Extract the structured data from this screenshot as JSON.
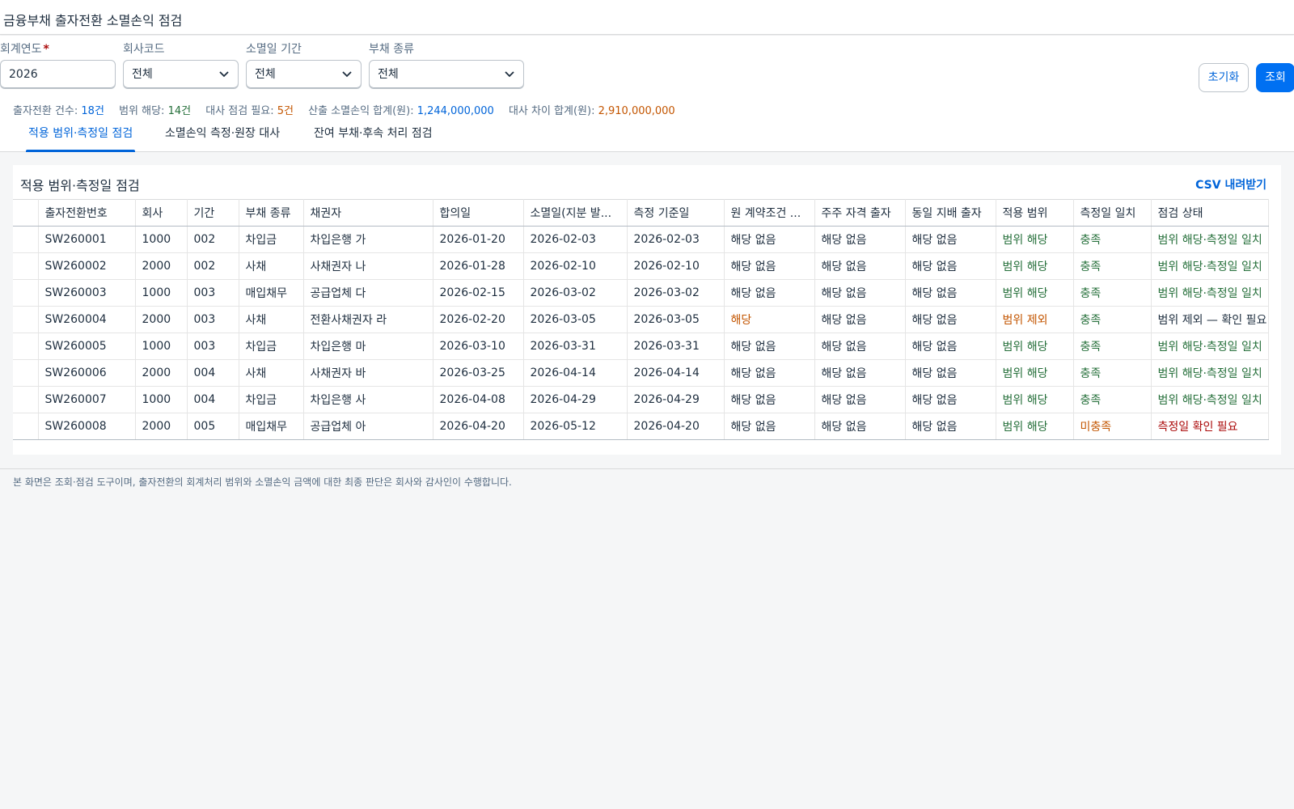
{
  "app": {
    "title": "금융부채 출자전환 소멸손익 점검"
  },
  "filters": [
    {
      "label": "회계연도",
      "required": true,
      "value": "2026",
      "type": "input"
    },
    {
      "label": "회사코드",
      "required": false,
      "value": "전체",
      "type": "select"
    },
    {
      "label": "소멸일 기간",
      "required": false,
      "value": "전체",
      "type": "select"
    },
    {
      "label": "부채 종류",
      "required": false,
      "value": "전체",
      "type": "select"
    }
  ],
  "buttons": {
    "reset": "초기화",
    "search": "조회"
  },
  "stats": [
    {
      "label": "출자전환 건수: ",
      "value": "18건",
      "tone": "blue"
    },
    {
      "label": "범위 해당: ",
      "value": "14건",
      "tone": "green"
    },
    {
      "label": "대사 점검 필요: ",
      "value": "5건",
      "tone": "orange"
    },
    {
      "label": "산출 소멸손익 합계(원): ",
      "value": "1,244,000,000",
      "tone": "blue"
    },
    {
      "label": "대사 차이 합계(원): ",
      "value": "2,910,000,000",
      "tone": "orange"
    }
  ],
  "tabs": [
    {
      "label": "적용 범위·측정일 점검",
      "active": true
    },
    {
      "label": "소멸손익 측정·원장 대사",
      "active": false
    },
    {
      "label": "잔여 부채·후속 처리 점검",
      "active": false
    }
  ],
  "panel": {
    "title": "적용 범위·측정일 점검",
    "csv_label": "CSV 내려받기"
  },
  "table": {
    "columns": [
      "",
      "출자전환번호",
      "회사",
      "기간",
      "부채 종류",
      "채권자",
      "합의일",
      "소멸일(지분 발...",
      "측정 기준일",
      "원 계약조건 ...",
      "주주 자격 출자",
      "동일 지배 출자",
      "적용 범위",
      "측정일 일치",
      "점검 상태"
    ],
    "rows": [
      {
        "id": "SW260001",
        "company": "1000",
        "period": "002",
        "type": "차입금",
        "creditor": "차입은행 가",
        "agree": "2026-01-20",
        "extinguish": "2026-02-03",
        "measure": "2026-02-03",
        "orig": "해당 없음",
        "orig_tone": "",
        "shareholder": "해당 없음",
        "control": "해당 없음",
        "scope": "범위 해당",
        "scope_tone": "green",
        "match": "충족",
        "match_tone": "green",
        "status": "범위 해당·측정일 일치",
        "status_tone": "green"
      },
      {
        "id": "SW260002",
        "company": "2000",
        "period": "002",
        "type": "사채",
        "creditor": "사채권자 나",
        "agree": "2026-01-28",
        "extinguish": "2026-02-10",
        "measure": "2026-02-10",
        "orig": "해당 없음",
        "orig_tone": "",
        "shareholder": "해당 없음",
        "control": "해당 없음",
        "scope": "범위 해당",
        "scope_tone": "green",
        "match": "충족",
        "match_tone": "green",
        "status": "범위 해당·측정일 일치",
        "status_tone": "green"
      },
      {
        "id": "SW260003",
        "company": "1000",
        "period": "003",
        "type": "매입채무",
        "creditor": "공급업체 다",
        "agree": "2026-02-15",
        "extinguish": "2026-03-02",
        "measure": "2026-03-02",
        "orig": "해당 없음",
        "orig_tone": "",
        "shareholder": "해당 없음",
        "control": "해당 없음",
        "scope": "범위 해당",
        "scope_tone": "green",
        "match": "충족",
        "match_tone": "green",
        "status": "범위 해당·측정일 일치",
        "status_tone": "green"
      },
      {
        "id": "SW260004",
        "company": "2000",
        "period": "003",
        "type": "사채",
        "creditor": "전환사채권자 라",
        "agree": "2026-02-20",
        "extinguish": "2026-03-05",
        "measure": "2026-03-05",
        "orig": "해당",
        "orig_tone": "orange",
        "shareholder": "해당 없음",
        "control": "해당 없음",
        "scope": "범위 제외",
        "scope_tone": "orange",
        "match": "충족",
        "match_tone": "green",
        "status": "범위 제외 — 확인 필요",
        "status_tone": ""
      },
      {
        "id": "SW260005",
        "company": "1000",
        "period": "003",
        "type": "차입금",
        "creditor": "차입은행 마",
        "agree": "2026-03-10",
        "extinguish": "2026-03-31",
        "measure": "2026-03-31",
        "orig": "해당 없음",
        "orig_tone": "",
        "shareholder": "해당 없음",
        "control": "해당 없음",
        "scope": "범위 해당",
        "scope_tone": "green",
        "match": "충족",
        "match_tone": "green",
        "status": "범위 해당·측정일 일치",
        "status_tone": "green"
      },
      {
        "id": "SW260006",
        "company": "2000",
        "period": "004",
        "type": "사채",
        "creditor": "사채권자 바",
        "agree": "2026-03-25",
        "extinguish": "2026-04-14",
        "measure": "2026-04-14",
        "orig": "해당 없음",
        "orig_tone": "",
        "shareholder": "해당 없음",
        "control": "해당 없음",
        "scope": "범위 해당",
        "scope_tone": "green",
        "match": "충족",
        "match_tone": "green",
        "status": "범위 해당·측정일 일치",
        "status_tone": "green"
      },
      {
        "id": "SW260007",
        "company": "1000",
        "period": "004",
        "type": "차입금",
        "creditor": "차입은행 사",
        "agree": "2026-04-08",
        "extinguish": "2026-04-29",
        "measure": "2026-04-29",
        "orig": "해당 없음",
        "orig_tone": "",
        "shareholder": "해당 없음",
        "control": "해당 없음",
        "scope": "범위 해당",
        "scope_tone": "green",
        "match": "충족",
        "match_tone": "green",
        "status": "범위 해당·측정일 일치",
        "status_tone": "green"
      },
      {
        "id": "SW260008",
        "company": "2000",
        "period": "005",
        "type": "매입채무",
        "creditor": "공급업체 아",
        "agree": "2026-04-20",
        "extinguish": "2026-05-12",
        "measure": "2026-04-20",
        "orig": "해당 없음",
        "orig_tone": "",
        "shareholder": "해당 없음",
        "control": "해당 없음",
        "scope": "범위 해당",
        "scope_tone": "green",
        "match": "미충족",
        "match_tone": "orange",
        "status": "측정일 확인 필요",
        "status_tone": "red"
      }
    ]
  },
  "footer": {
    "note": "본 화면은 조회·점검 도구이며, 출자전환의 회계처리 범위와 소멸손익 금액에 대한 최종 판단은 회사와 감사인이 수행합니다."
  },
  "colors": {
    "accent": "#0064d9",
    "primary_button": "#0070f2",
    "positive": "#256f3a",
    "warning": "#c35500",
    "negative": "#aa0808"
  },
  "icons": {
    "select_chevron": "chevron-down-icon",
    "required_marker": "asterisk"
  }
}
